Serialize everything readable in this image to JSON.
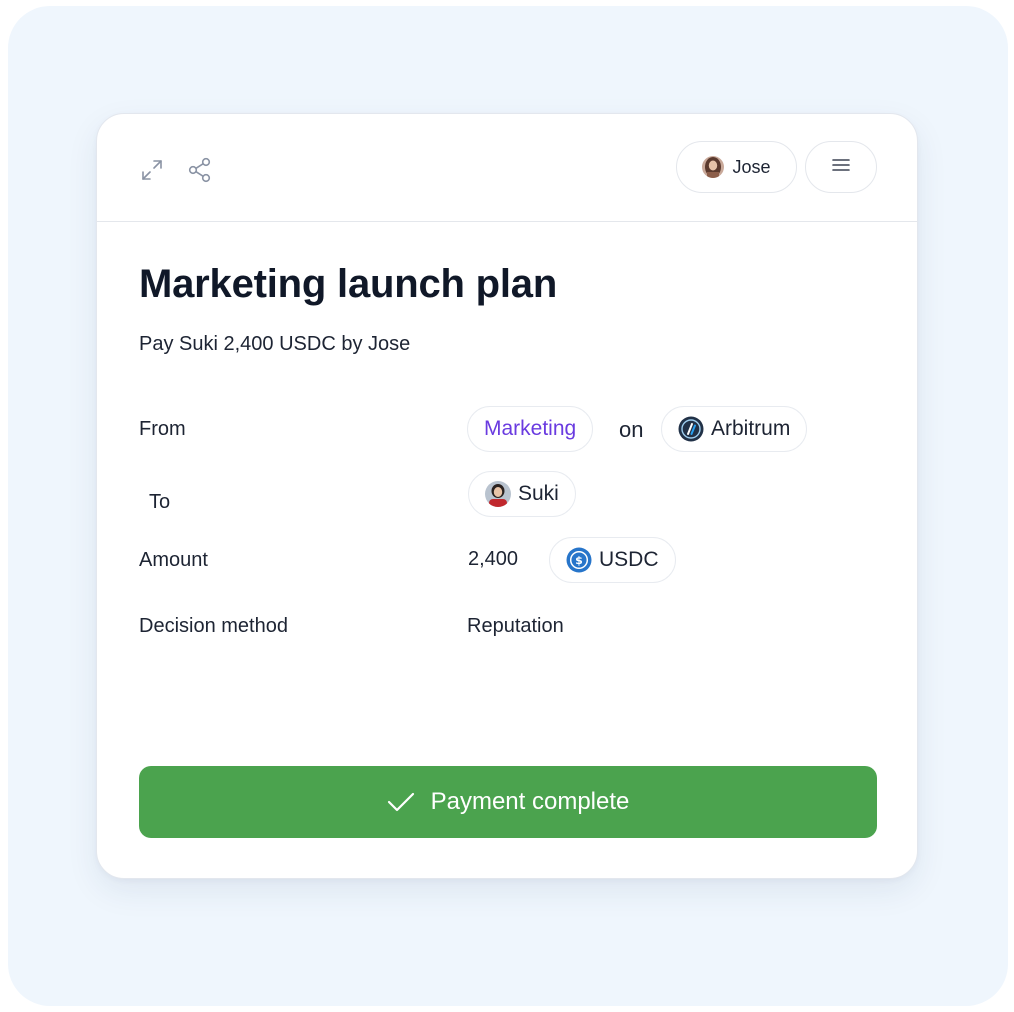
{
  "header": {
    "user_button": {
      "label": "Jose",
      "avatar": "jose-avatar"
    },
    "menu_icon": "hamburger-icon",
    "expand_icon": "expand-icon",
    "share_icon": "share-icon"
  },
  "action": {
    "title": "Marketing launch plan",
    "summary": "Pay Suki 2,400 USDC by Jose"
  },
  "details": {
    "from": {
      "label": "From",
      "team": "Marketing",
      "connector": "on",
      "network": "Arbitrum"
    },
    "to": {
      "label": "To",
      "recipient": "Suki"
    },
    "amount": {
      "label": "Amount",
      "value": "2,400",
      "token": "USDC"
    },
    "decision_method": {
      "label": "Decision method",
      "value": "Reputation"
    }
  },
  "status": {
    "label": "Payment complete",
    "icon": "check-icon",
    "color": "#4ba34e"
  },
  "colors": {
    "backdrop": "#eff6fd",
    "team_accent": "#6a3be0",
    "text": "#1d2433"
  }
}
